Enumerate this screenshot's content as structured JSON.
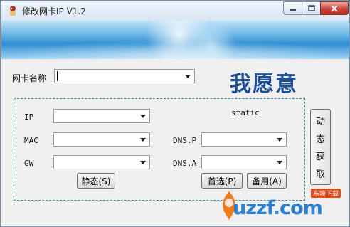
{
  "window": {
    "title": "修改网卡IP V1.2"
  },
  "banner": {},
  "adapter": {
    "label": "网卡名称",
    "value": ""
  },
  "slogan": "我愿意",
  "fields": {
    "ip_label": "IP",
    "mac_label": "MAC",
    "gw_label": "GW",
    "dnsp_label": "DNS.P",
    "dnsa_label": "DNS.A",
    "static_label": "static"
  },
  "buttons": {
    "static": "静态(S)",
    "preferred": "首选(P)",
    "backup": "备用(A)",
    "dynamic": [
      "动",
      "态",
      "获",
      "取"
    ]
  },
  "watermark": {
    "tag": "东坡下载",
    "text": "uzzf.com"
  },
  "colors": {
    "slogan": "#1f4f97",
    "group_border": "#3b8aa0",
    "close": "#c8443a"
  }
}
